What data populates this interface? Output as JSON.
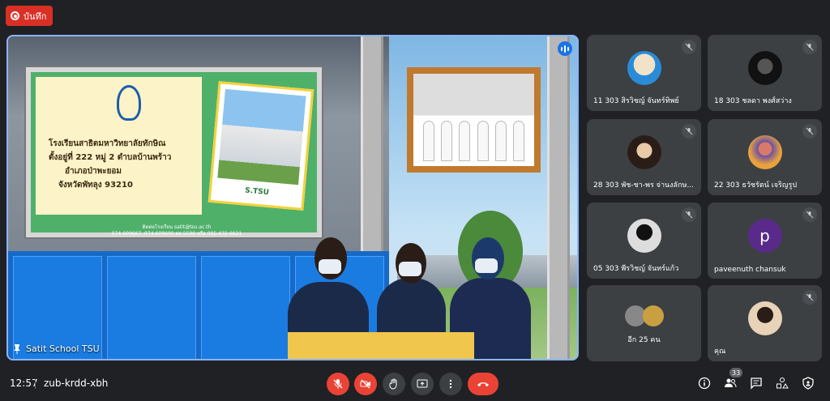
{
  "record_button": {
    "label": "บันทึก"
  },
  "main_video": {
    "presenter_name": "Satit School TSU",
    "board": {
      "school_name": "โรงเรียนสาธิตมหาวิทยาลัยทักษิณ",
      "address_line1": "ตั้งอยู่ที่ 222 หมู่ 2 ตำบลบ้านพร้าว",
      "address_line2": "อำเภอป่าพะยอม",
      "address_line3": "จังหวัดพัทลุง 93210",
      "contact_line1": "ติดต่อโรงเรียน satit@tsu.ac.th",
      "contact_line2": "074-609667, 074-609600 ต่อ 5500 หรือ 095-432-6621",
      "photo_label": "S.TSU"
    }
  },
  "participants": [
    {
      "name": "11 303 สิรวิชญ์ จันทร์ทิพย์",
      "avatar": "dog-sunglasses"
    },
    {
      "name": "18 303 ชลดา พงศ์สว่าง",
      "avatar": "dark-photo"
    },
    {
      "name": "28 303 พัช-ชา-พร จ่านงลักษ...",
      "avatar": "girl-photo"
    },
    {
      "name": "22 303 ธวัชรัตน์ เจริญรูป",
      "avatar": "girl-flowers"
    },
    {
      "name": "05 303 พีรวิชญ์ จันทร์แก้ว",
      "avatar": "masked-figure"
    },
    {
      "name": "paveenuth chansuk",
      "avatar_letter": "p",
      "avatar_color": "#5a2a8a"
    },
    {
      "name": "อีก 25 คน",
      "avatar": "group"
    },
    {
      "name": "คุณ",
      "avatar": "self-photo"
    }
  ],
  "bottom_bar": {
    "time": "12:57",
    "meeting_code": "zub-krdd-xbh",
    "people_count": "33"
  },
  "colors": {
    "accent": "#8ab4f8",
    "danger": "#ea4335",
    "record": "#d93025"
  }
}
